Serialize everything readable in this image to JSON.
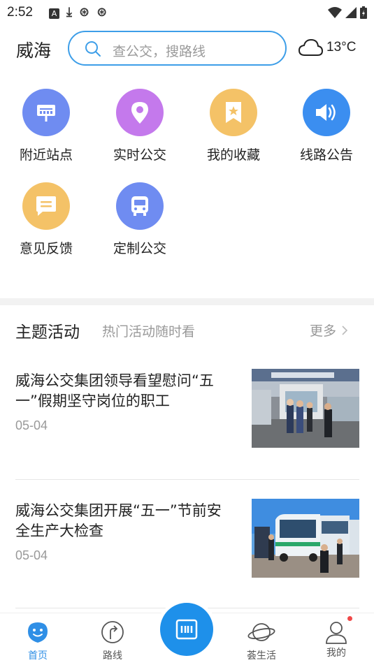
{
  "status_bar": {
    "time": "2:52"
  },
  "header": {
    "city": "威海",
    "search_placeholder": "查公交，搜路线",
    "weather": "13°C"
  },
  "colors": {
    "accent": "#2f8fe6",
    "nearby": "#6f8cf1",
    "realtime": "#c479ec",
    "favorites": "#f4c267",
    "notice": "#3b8ef0",
    "feedback": "#f4c267",
    "custom": "#6f8cf1"
  },
  "shortcuts": [
    {
      "label": "附近站点",
      "icon": "bus-stop-sign-icon"
    },
    {
      "label": "实时公交",
      "icon": "location-pin-icon"
    },
    {
      "label": "我的收藏",
      "icon": "bookmark-star-icon"
    },
    {
      "label": "线路公告",
      "icon": "speaker-icon"
    },
    {
      "label": "意见反馈",
      "icon": "message-icon"
    },
    {
      "label": "定制公交",
      "icon": "bus-icon"
    }
  ],
  "section": {
    "title": "主题活动",
    "subtitle": "热门活动随时看",
    "more": "更多"
  },
  "news": [
    {
      "title": "威海公交集团领导看望慰问“五一”假期坚守岗位的职工",
      "date": "05-04"
    },
    {
      "title": "威海公交集团开展“五一”节前安全生产大检查",
      "date": "05-04"
    }
  ],
  "bottom_nav": [
    {
      "label": "首页",
      "icon": "home-face-icon",
      "active": true
    },
    {
      "label": "路线",
      "icon": "route-icon",
      "active": false
    },
    {
      "label": "",
      "icon": "scan-card-icon",
      "active": false
    },
    {
      "label": "荟生活",
      "icon": "planet-icon",
      "active": false
    },
    {
      "label": "我的",
      "icon": "profile-icon",
      "active": false
    }
  ]
}
